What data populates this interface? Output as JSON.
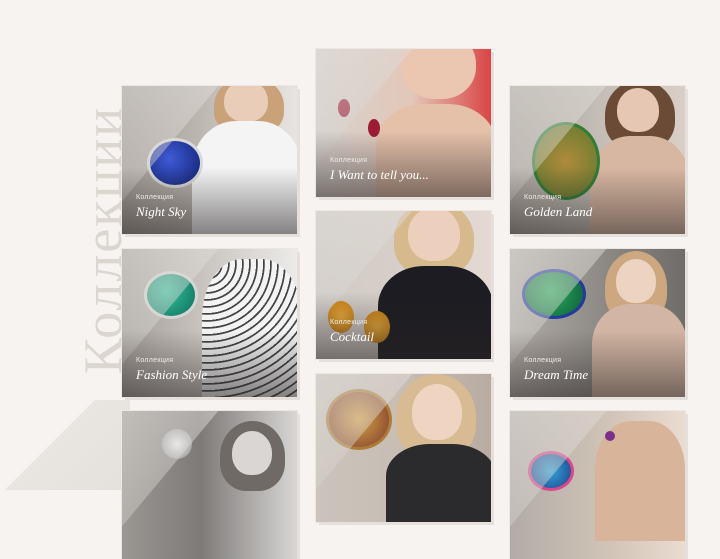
{
  "page": {
    "vertical_title": "Коллекции"
  },
  "colors": {
    "background": "#f6f3f0",
    "title": "#dcd6d1",
    "label": "#ffffff"
  },
  "cards": [
    {
      "small": "Коллекция",
      "name": "Night Sky"
    },
    {
      "small": "Коллекция",
      "name": "I Want to tell you..."
    },
    {
      "small": "Коллекция",
      "name": "Golden Land"
    },
    {
      "small": "Коллекция",
      "name": "Fashion Style"
    },
    {
      "small": "Коллекция",
      "name": "Cocktail"
    },
    {
      "small": "Коллекция",
      "name": "Dream Time"
    },
    {
      "small": "",
      "name": ""
    },
    {
      "small": "",
      "name": ""
    },
    {
      "small": "",
      "name": ""
    }
  ]
}
